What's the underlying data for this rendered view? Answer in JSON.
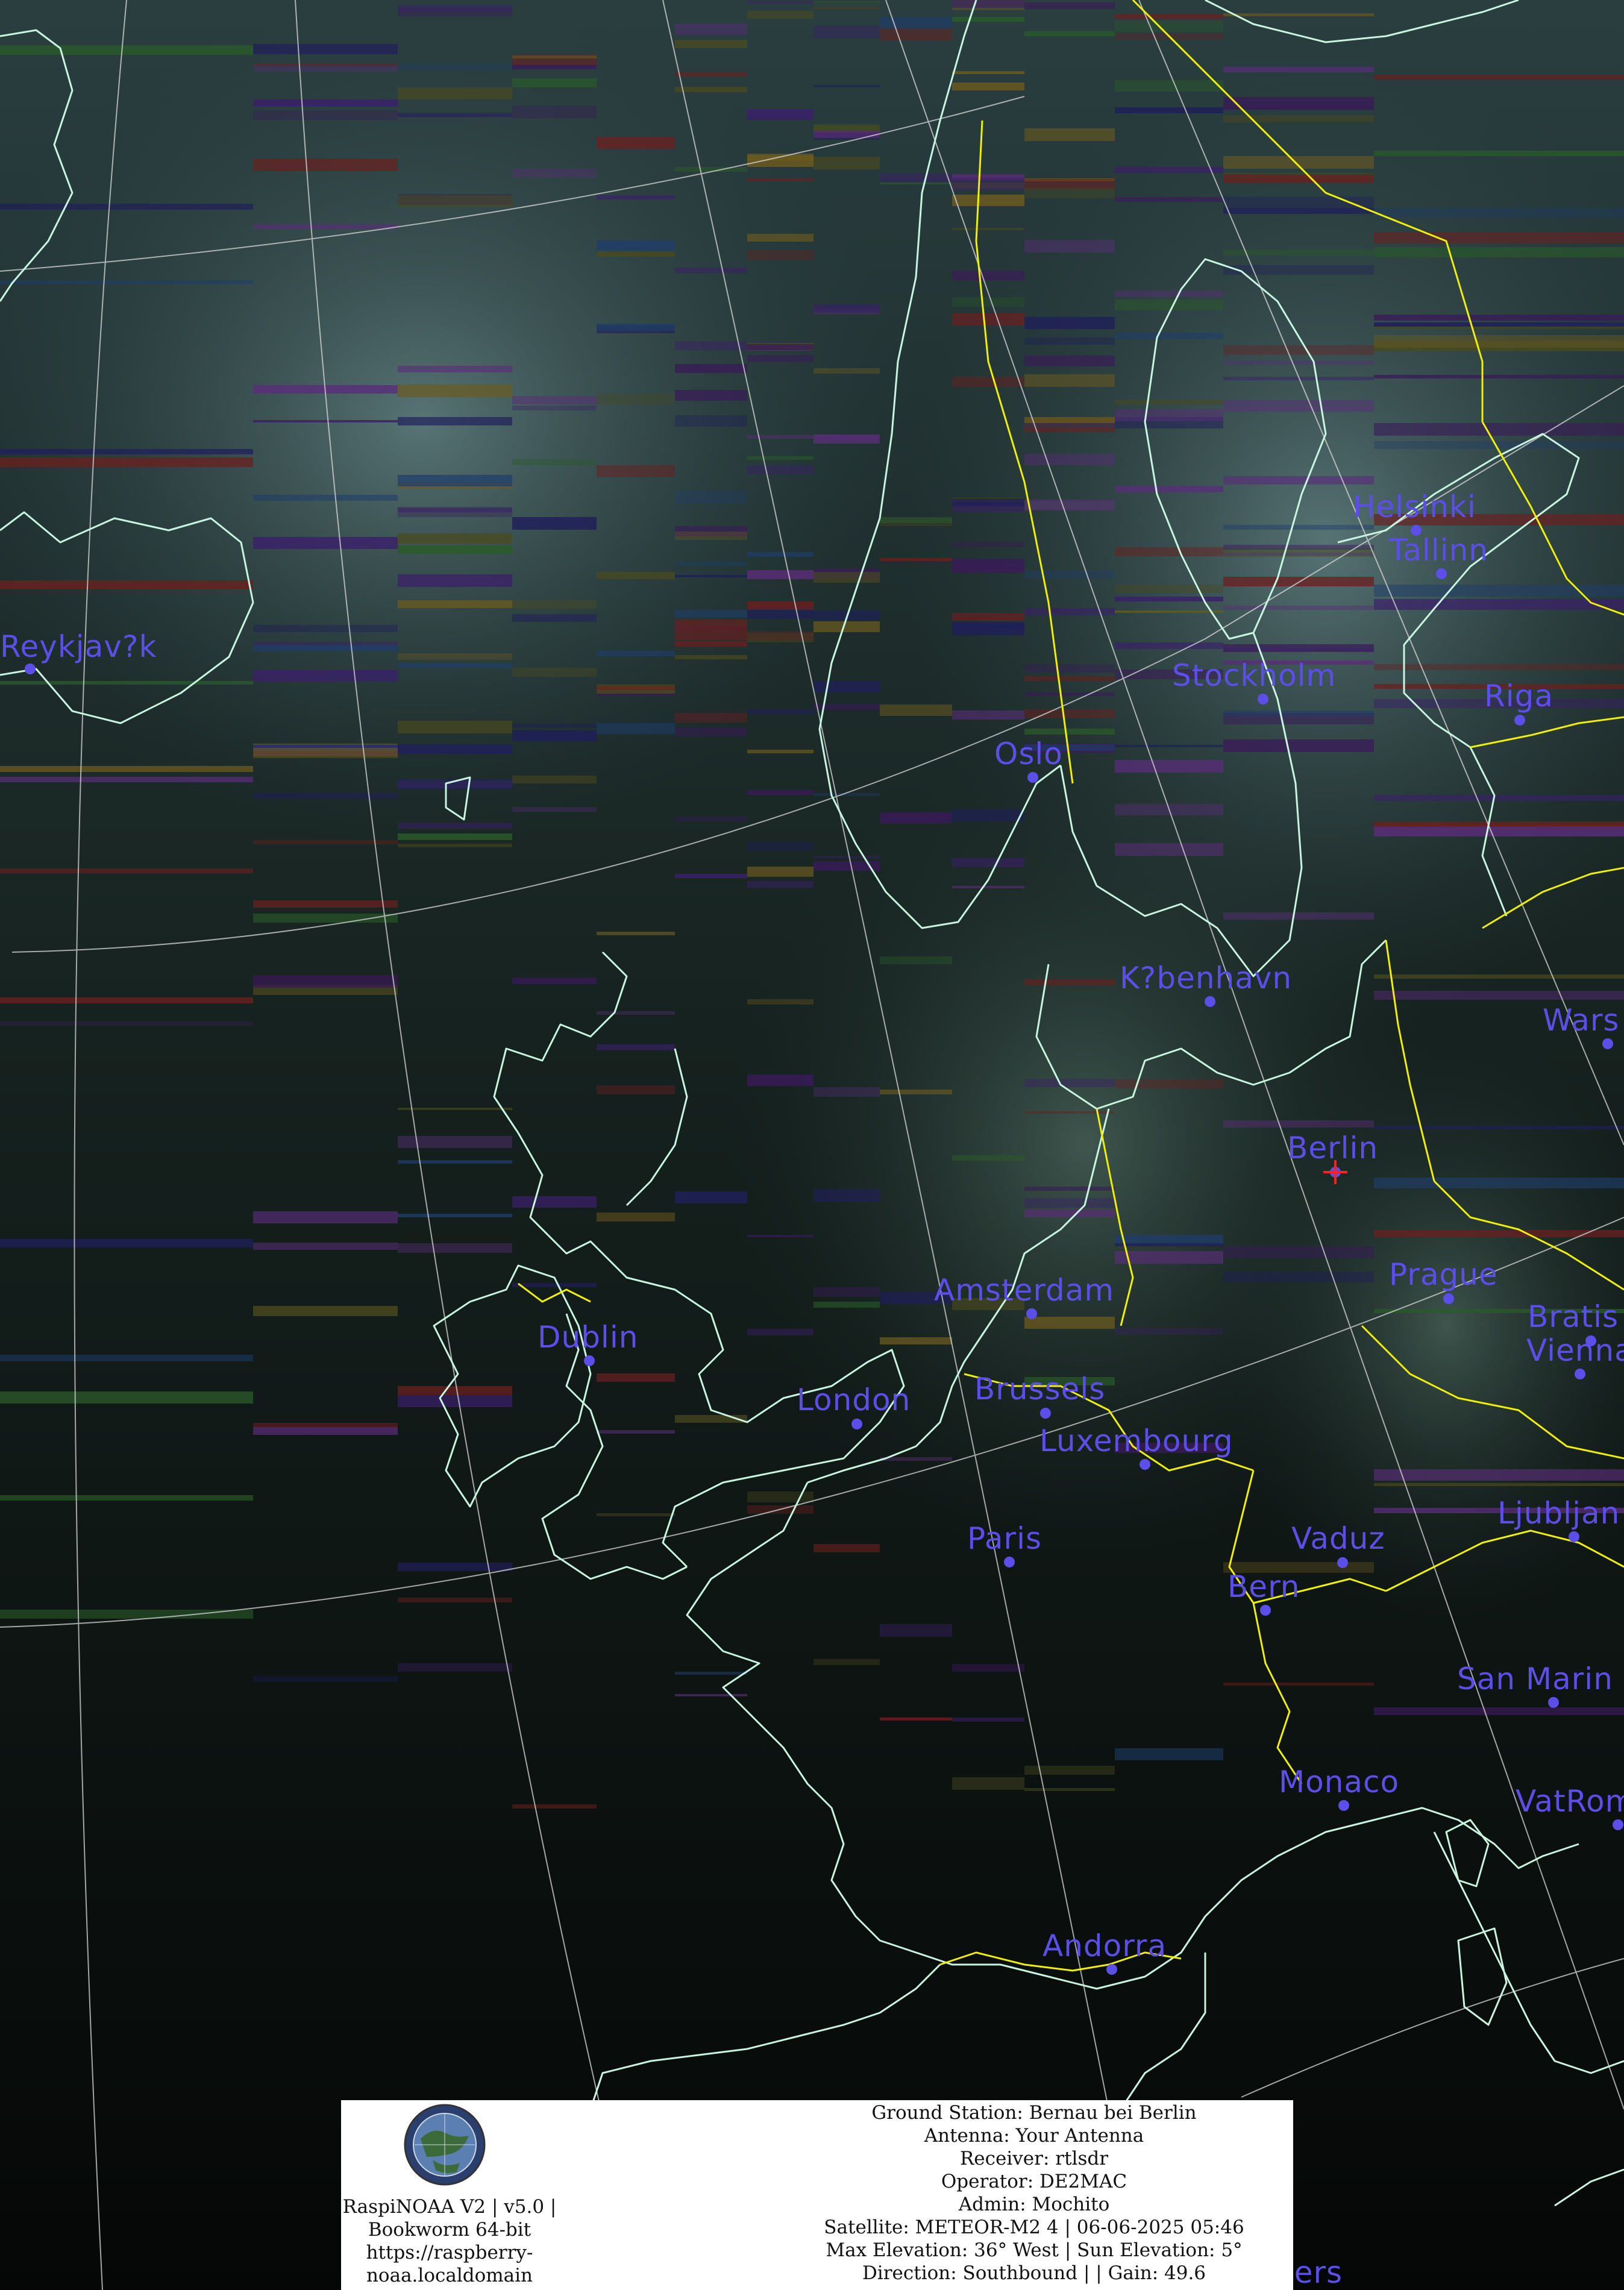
{
  "map": {
    "cities": [
      {
        "name": "Reykjav?k"
      },
      {
        "name": "Helsinki"
      },
      {
        "name": "Tallinn"
      },
      {
        "name": "Stockholm"
      },
      {
        "name": "Riga"
      },
      {
        "name": "Oslo"
      },
      {
        "name": "K?benhavn"
      },
      {
        "name": "Wars"
      },
      {
        "name": "Berlin"
      },
      {
        "name": "Amsterdam"
      },
      {
        "name": "Prague"
      },
      {
        "name": "Bratis"
      },
      {
        "name": "Vienna"
      },
      {
        "name": "Dublin"
      },
      {
        "name": "London"
      },
      {
        "name": "Brussels"
      },
      {
        "name": "Luxembourg"
      },
      {
        "name": "Ljubljan"
      },
      {
        "name": "Paris"
      },
      {
        "name": "Vaduz"
      },
      {
        "name": "Bern"
      },
      {
        "name": "San Marin"
      },
      {
        "name": "Monaco"
      },
      {
        "name": "VatRom"
      },
      {
        "name": "Andorra"
      },
      {
        "name": "Algiers"
      }
    ],
    "colors": {
      "coastline": "#c8f5e0",
      "border": "#f0f000",
      "graticule": "#d8d8d8",
      "city": "#5c4ee8",
      "station_marker": "#ff2020"
    }
  },
  "panel": {
    "logo_icon": "raspinoaa-globe-logo",
    "station_lines": [
      "RaspiNOAA V2 | v5.0 |",
      "Bookworm 64-bit",
      "https://raspberry-",
      "noaa.localdomain"
    ],
    "details": [
      "Ground Station: Bernau bei Berlin",
      "Antenna: Your Antenna",
      "Receiver: rtlsdr",
      "Operator: DE2MAC",
      "Admin: Mochito",
      "Satellite: METEOR-M2 4 | 06-06-2025 05:46",
      "Max Elevation: 36° West | Sun Elevation: 5°",
      "Direction: Southbound | | Gain: 49.6"
    ]
  }
}
